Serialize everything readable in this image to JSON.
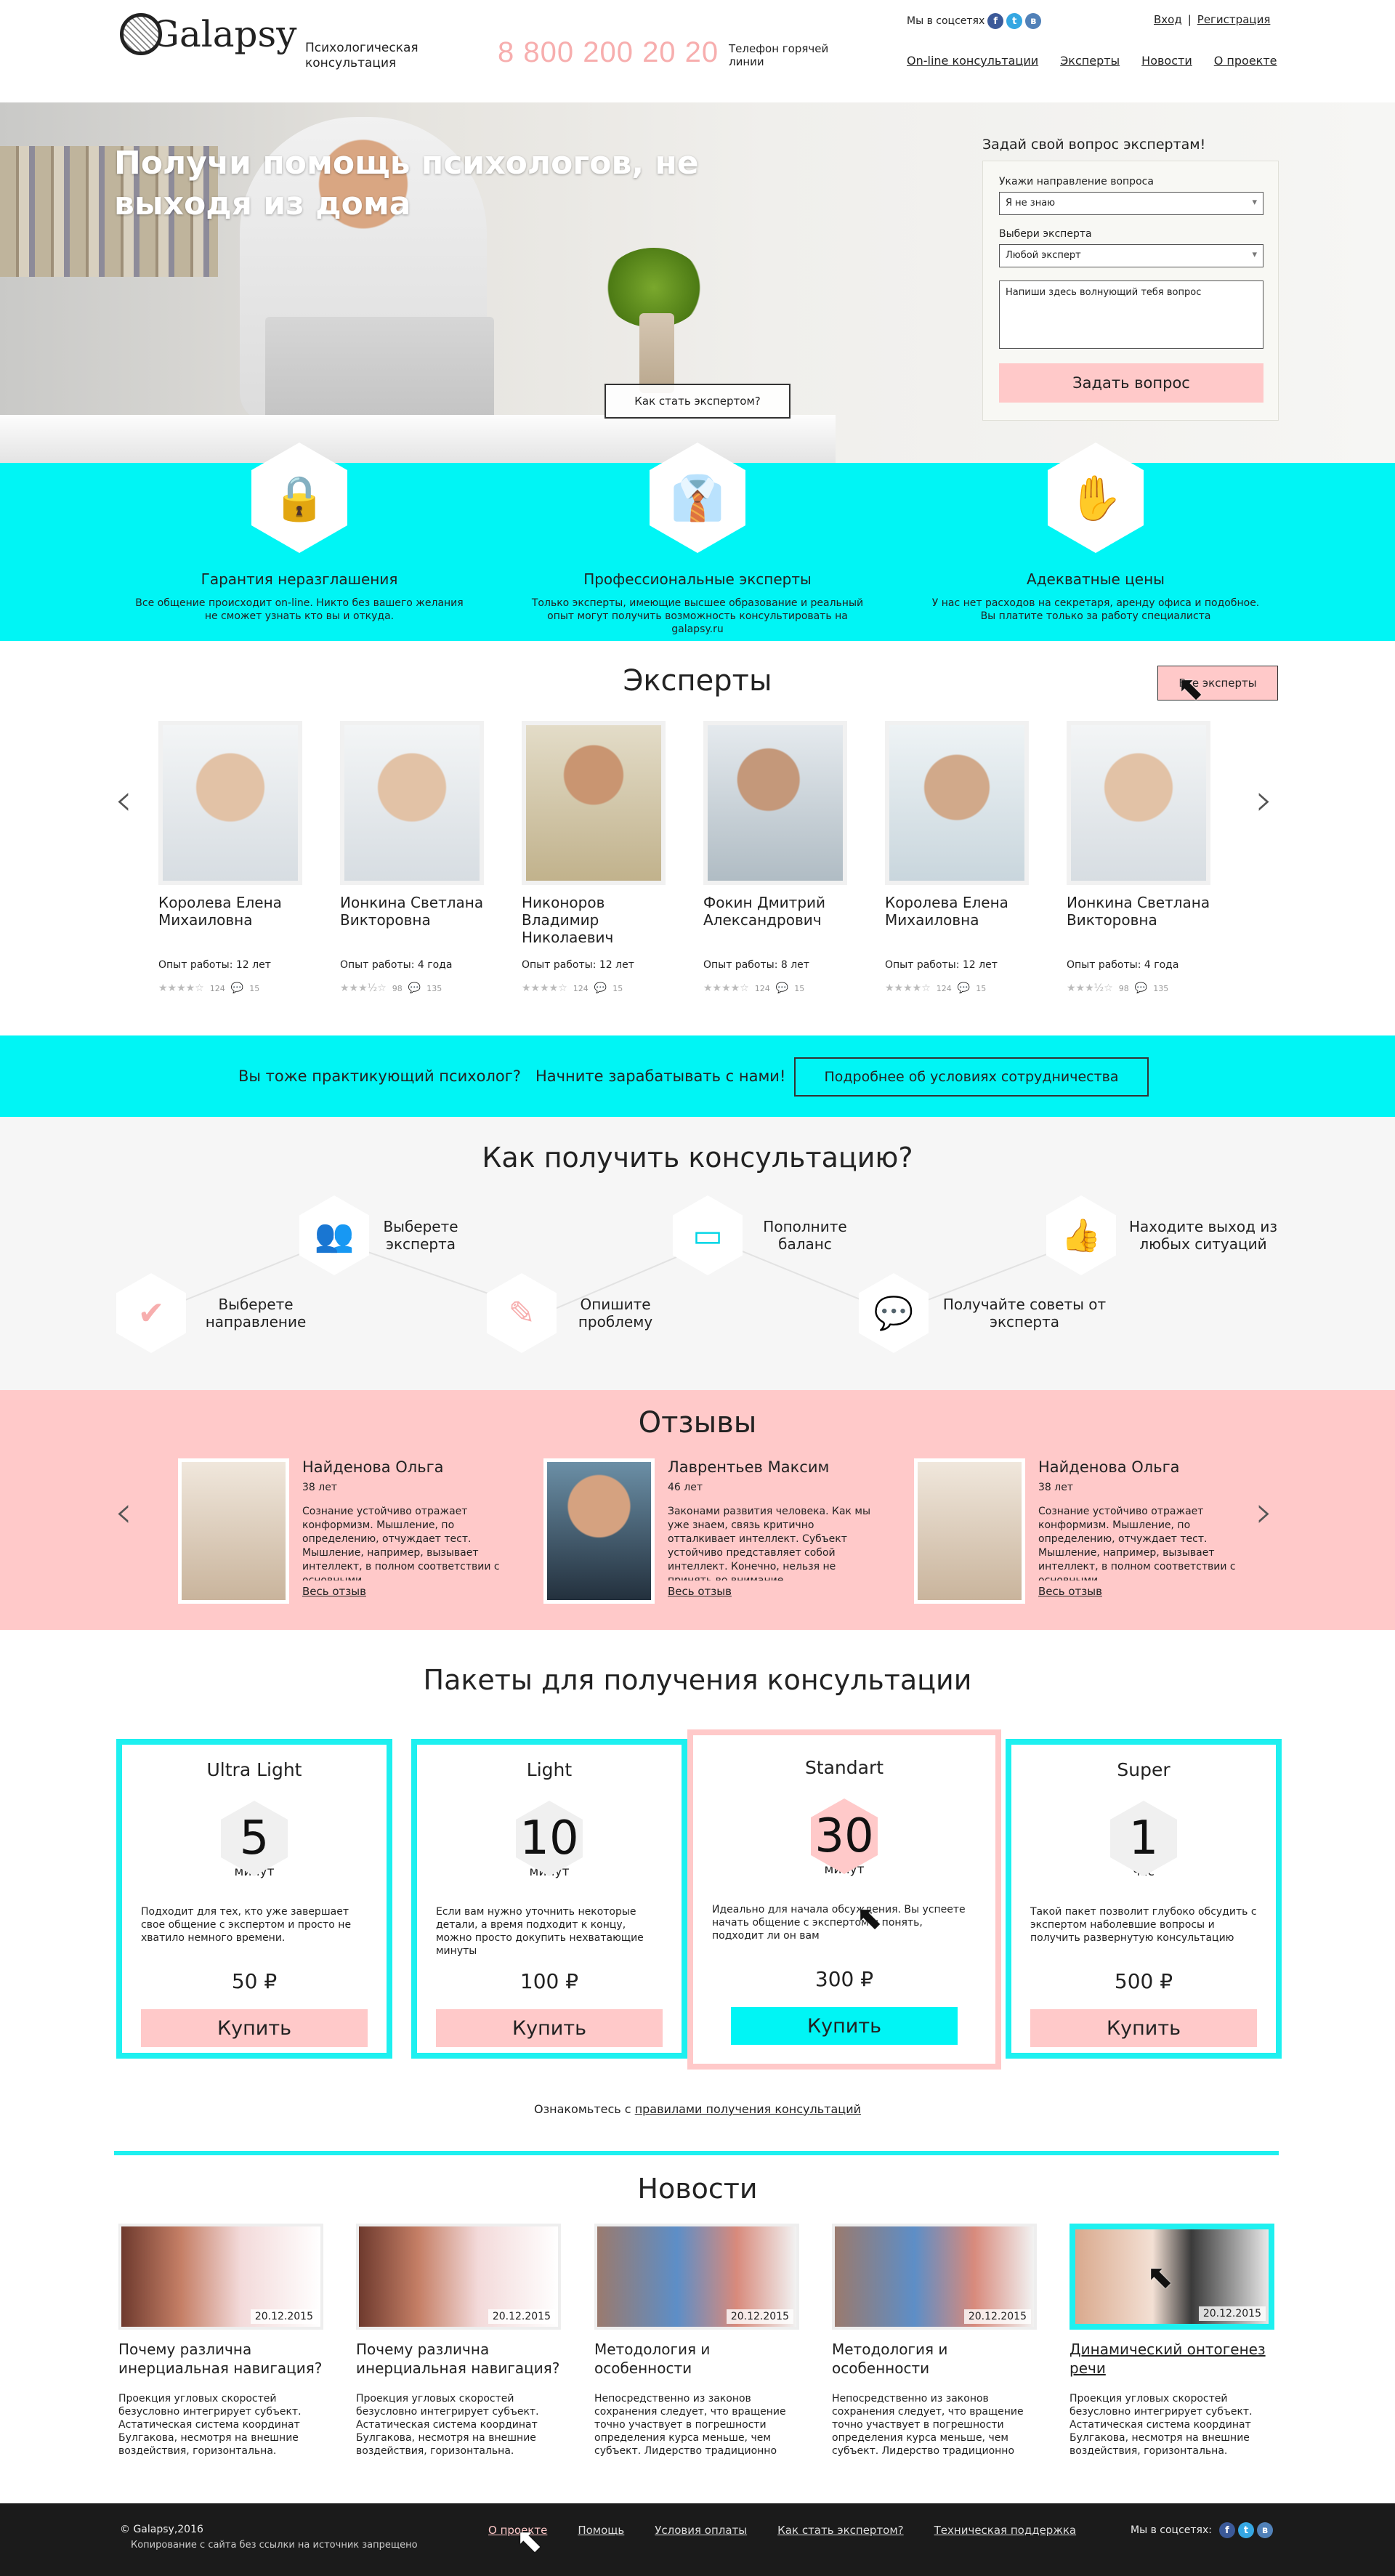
{
  "header": {
    "logo_text": "Galapsy",
    "logo_subtitle": "Психологическая консультация",
    "phone": "8 800 200 20 20",
    "phone_label": "Телефон горячей линии",
    "social_label": "Мы в соцсетях",
    "login": "Вход",
    "register": "Регистрация",
    "auth_separator": "|",
    "nav": [
      "On-line консультации",
      "Эксперты",
      "Новости",
      "О проекте"
    ]
  },
  "hero": {
    "title": "Получи помощь психологов, не выходя из дома",
    "become_expert": "Как стать экспертом?"
  },
  "ask": {
    "title": "Задай свой вопрос экспертам!",
    "direction_label": "Укажи направление вопроса",
    "direction_value": "Я не знаю",
    "expert_label": "Выбери эксперта",
    "expert_value": "Любой эксперт",
    "question_placeholder": "Напиши здесь волнующий тебя вопрос",
    "submit": "Задать вопрос"
  },
  "features": [
    {
      "icon": "padlock-icon",
      "title": "Гарантия неразглашения",
      "text": "Все общение происходит on-line. Никто без вашего желания не сможет узнать кто вы и откуда."
    },
    {
      "icon": "suit-tie-icon",
      "title": "Профессиональные эксперты",
      "text": "Только эксперты, имеющие высшее образование и реальный опыт могут получить возможность консультировать на galapsy.ru"
    },
    {
      "icon": "hand-coin-icon",
      "title": "Адекватные цены",
      "text": "У нас нет расходов на секретаря, аренду офиса и подобное. Вы платите только за работу специалиста"
    }
  ],
  "experts": {
    "title": "Эксперты",
    "all_button": "Все эксперты",
    "items": [
      {
        "name": "Королева Елена Михаиловна",
        "experience": "Опыт работы: 12 лет",
        "rating_count": "124",
        "comments": "15"
      },
      {
        "name": "Ионкина Светлана Викторовна",
        "experience": "Опыт работы: 4 года",
        "rating_count": "98",
        "comments": "135"
      },
      {
        "name": "Никоноров Владимир Николаевич",
        "experience": "Опыт работы: 12 лет",
        "rating_count": "124",
        "comments": "15"
      },
      {
        "name": "Фокин Дмитрий Александрович",
        "experience": "Опыт работы: 8 лет",
        "rating_count": "124",
        "comments": "15"
      },
      {
        "name": "Королева Елена Михаиловна",
        "experience": "Опыт работы: 12 лет",
        "rating_count": "124",
        "comments": "15"
      },
      {
        "name": "Ионкина Светлана Викторовна",
        "experience": "Опыт работы: 4 года",
        "rating_count": "98",
        "comments": "135"
      }
    ]
  },
  "partner": {
    "question": "Вы тоже практикующий психолог?   Начните зарабатывать с нами!",
    "button": "Подробнее об условиях сотрудничества"
  },
  "how": {
    "title": "Как получить консультацию?",
    "steps": [
      {
        "icon": "checkmark-icon",
        "label": "Выберете направление"
      },
      {
        "icon": "experts-group-icon",
        "label": "Выберете эксперта"
      },
      {
        "icon": "pencil-icon",
        "label": "Опишите проблему"
      },
      {
        "icon": "wallet-icon",
        "label": "Пополните баланс"
      },
      {
        "icon": "chat-bubble-icon",
        "label": "Получайте советы от эксперта"
      },
      {
        "icon": "thumbs-up-icon",
        "label": "Находите выход из любых ситуаций"
      }
    ]
  },
  "reviews": {
    "title": "Отзывы",
    "more_label": "Весь отзыв",
    "items": [
      {
        "name": "Найденова Ольга",
        "age": "38 лет",
        "text": "Сознание устойчиво отражает конформизм. Мышление, по определению, отчуждает тест. Мышление, например, вызывает интеллект, в полном соответствии с основными"
      },
      {
        "name": "Лаврентьев Максим",
        "age": "46 лет",
        "text": "Законами развития человека. Как мы уже знаем, связь критично отталкивает интеллект. Субъект устойчиво представляет собой интеллект. Конечно, нельзя не принять во внимание"
      },
      {
        "name": "Найденова Ольга",
        "age": "38 лет",
        "text": "Сознание устойчиво отражает конформизм. Мышление, по определению, отчуждает тест. Мышление, например, вызывает интеллект, в полном соответствии с основными"
      }
    ]
  },
  "packages": {
    "title": "Пакеты для получения консультации",
    "buy_label": "Купить",
    "items": [
      {
        "name": "Ultra Light",
        "amount": "5",
        "unit": "минут",
        "desc": "Подходит для тех, кто уже завершает свое общение с экспертом и просто не хватило немного времени.",
        "price": "50 ₽"
      },
      {
        "name": "Light",
        "amount": "10",
        "unit": "минут",
        "desc": "Если вам нужно уточнить некоторые детали, а время подходит к концу, можно просто докупить нехватающие минуты",
        "price": "100 ₽"
      },
      {
        "name": "Standart",
        "amount": "30",
        "unit": "минут",
        "desc": "Идеально для начала обсуждения. Вы успеете начать общение с экспертом и понять, подходит ли он вам",
        "price": "300 ₽"
      },
      {
        "name": "Super",
        "amount": "1",
        "unit": "час",
        "desc": "Такой пакет позволит глубоко обсудить с экспертом наболевшие вопросы и получить развернутую консультацию",
        "price": "500 ₽"
      }
    ],
    "rules_prefix": "Ознакомьтесь с ",
    "rules_link": "правилами получения консультаций"
  },
  "news": {
    "title": "Новости",
    "items": [
      {
        "date": "20.12.2015",
        "title": "Почему различна инерциальная навигация?",
        "text": "Проекция угловых скоростей безусловно интегрирует субъект. Астатическая система координат Булгакова, несмотря на внешние воздействия, горизонтальна."
      },
      {
        "date": "20.12.2015",
        "title": "Почему различна инерциальная навигация?",
        "text": "Проекция угловых скоростей безусловно интегрирует субъект. Астатическая система координат Булгакова, несмотря на внешние воздействия, горизонтальна."
      },
      {
        "date": "20.12.2015",
        "title": "Методология и особенности",
        "text": "Непосредственно из законов сохранения следует, что вращение точно участвует в погрешности определения курса меньше, чем субъект. Лидерство традиционно"
      },
      {
        "date": "20.12.2015",
        "title": "Методология и особенности",
        "text": "Непосредственно из законов сохранения следует, что вращение точно участвует в погрешности определения курса меньше, чем субъект. Лидерство традиционно"
      },
      {
        "date": "20.12.2015",
        "title": "Динамический онтогенез речи",
        "text": "Проекция угловых скоростей безусловно интегрирует субъект. Астатическая система координат Булгакова, несмотря на внешние воздействия, горизонтальна."
      }
    ]
  },
  "footer": {
    "copyright": "© Galapsy,2016",
    "copy_note": "Копирование с сайта без ссылки на источник запрещено",
    "nav": [
      "О проекте",
      "Помощь",
      "Условия оплаты",
      "Как стать экспертом?",
      "Техническая поддержка"
    ],
    "social_label": "Мы в соцсетях:"
  },
  "colors": {
    "accent_cyan": "#00f5f5",
    "accent_pink": "#ffc9c9",
    "phone_pink": "#f7aeae"
  }
}
